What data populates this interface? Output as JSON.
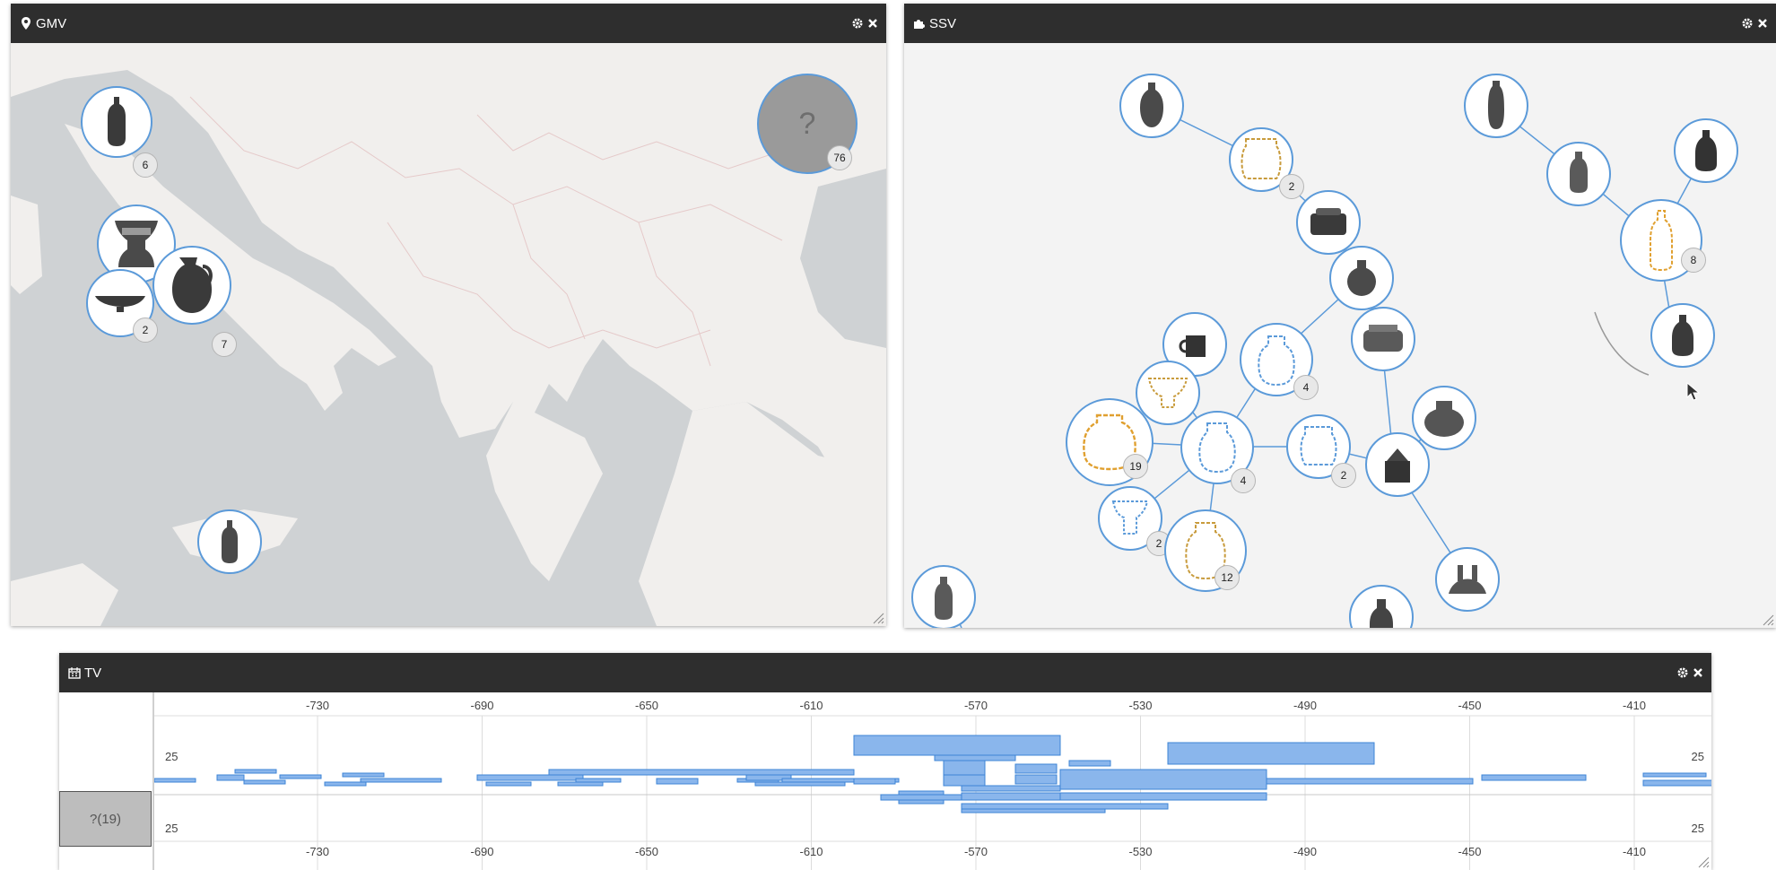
{
  "gmv": {
    "title": "GMV",
    "icon": "map-marker-icon",
    "clusters": [
      {
        "count": "6"
      },
      {
        "count": "7"
      },
      {
        "count": "7"
      },
      {
        "count": "2"
      },
      {
        "count": ""
      }
    ],
    "unknown": {
      "symbol": "?",
      "count": "76"
    }
  },
  "ssv": {
    "title": "SSV",
    "icon": "puzzle-icon",
    "badges": [
      "2",
      "8",
      "4",
      "2",
      "19",
      "4",
      "2",
      "2",
      "12"
    ]
  },
  "tv": {
    "title": "TV",
    "icon": "calendar-icon",
    "row_label": "?(19)",
    "ticks": [
      "-730",
      "-690",
      "-650",
      "-610",
      "-570",
      "-530",
      "-490",
      "-450",
      "-410"
    ],
    "scale_label": "25",
    "colors": {
      "bar": "#8ab6ec",
      "bar_stroke": "#3d84d6"
    }
  }
}
